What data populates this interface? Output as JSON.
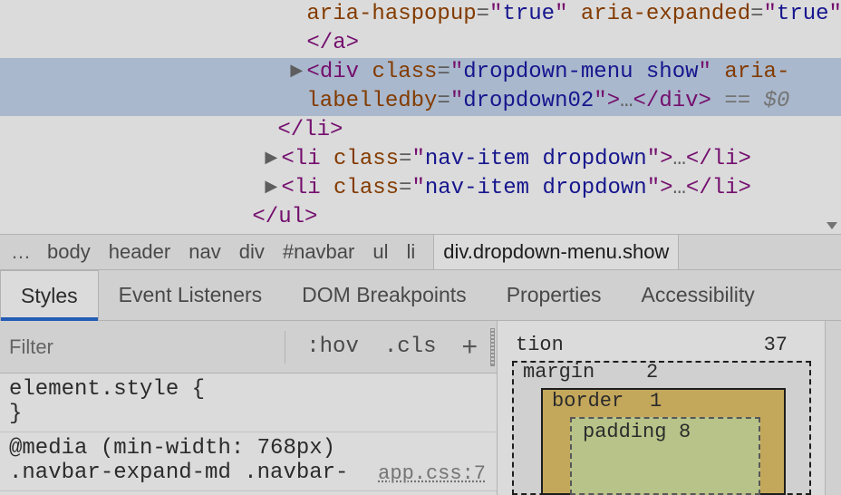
{
  "dom": {
    "line0a": {
      "indent": 324,
      "attr1_name": "aria-haspopup",
      "attr1_val": "true",
      "attr2_name": "aria-expanded",
      "attr2_val": "true",
      "tail": ">…"
    },
    "line0b": {
      "indent": 324,
      "tagname": "a"
    },
    "lineSel": {
      "indent": 306,
      "tri": "▶",
      "tagname": "div",
      "attr1_name": "class",
      "attr1_val": "dropdown-menu show",
      "attr2_name": "aria-",
      "cont_name": "labelledby",
      "cont_val": "dropdown02",
      "close_tag": "div",
      "dollar": "== $0"
    },
    "lineLiClose": {
      "indent": 292,
      "tagname": "li"
    },
    "lineLi1": {
      "indent": 278,
      "tri": "▶",
      "tagname": "li",
      "attr_name": "class",
      "attr_val": "nav-item dropdown",
      "close_tag": "li"
    },
    "lineLi2": {
      "indent": 278,
      "tri": "▶",
      "tagname": "li",
      "attr_name": "class",
      "attr_val": "nav-item dropdown",
      "close_tag": "li"
    },
    "lineUlClose": {
      "indent": 264,
      "tagname": "ul"
    },
    "row_ellipsis": "•••"
  },
  "breadcrumb": {
    "ellipsis": "…",
    "items": [
      "body",
      "header",
      "nav",
      "div",
      "#navbar",
      "ul",
      "li"
    ],
    "selected": "div.dropdown-menu.show"
  },
  "tabs": {
    "styles": "Styles",
    "event": "Event Listeners",
    "dom": "DOM Breakpoints",
    "props": "Properties",
    "a11y": "Accessibility",
    "active": "styles"
  },
  "styles_toolbar": {
    "filter_placeholder": "Filter",
    "hov": ":hov",
    "cls": ".cls",
    "plus": "+"
  },
  "rules": {
    "element_style": {
      "selector": "element.style",
      "open": "{",
      "close": "}"
    },
    "rule1": {
      "media": "@media (min-width: 768px)",
      "selector_partial": ".navbar-expand-md .navbar-",
      "source": "app.css:7"
    }
  },
  "box_model": {
    "position": {
      "label": "tion",
      "value": "37"
    },
    "margin": {
      "label": "margin",
      "value": "2"
    },
    "border": {
      "label": "border",
      "value": "1"
    },
    "padding": {
      "label": "padding",
      "value": "8"
    }
  }
}
